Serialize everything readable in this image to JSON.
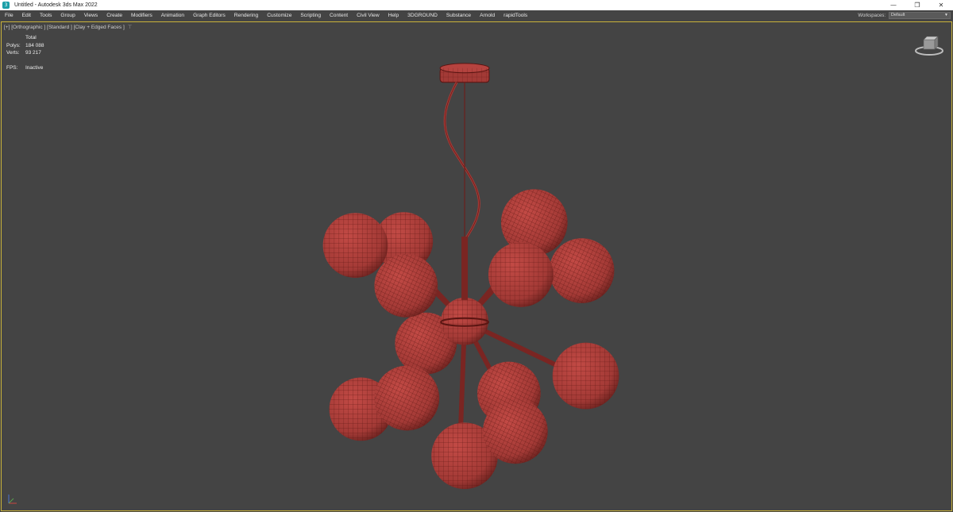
{
  "window": {
    "title": "Untitled - Autodesk 3ds Max 2022",
    "controls": {
      "minimize": "—",
      "restore": "❐",
      "close": "✕"
    }
  },
  "menubar": {
    "items": [
      {
        "label": "File"
      },
      {
        "label": "Edit"
      },
      {
        "label": "Tools"
      },
      {
        "label": "Group"
      },
      {
        "label": "Views"
      },
      {
        "label": "Create"
      },
      {
        "label": "Modifiers"
      },
      {
        "label": "Animation"
      },
      {
        "label": "Graph Editors"
      },
      {
        "label": "Rendering"
      },
      {
        "label": "Customize"
      },
      {
        "label": "Scripting"
      },
      {
        "label": "Content"
      },
      {
        "label": "Civil View"
      },
      {
        "label": "Help"
      },
      {
        "label": "3DGROUND"
      },
      {
        "label": "Substance"
      },
      {
        "label": "Arnold"
      },
      {
        "label": "rapidTools"
      }
    ],
    "workspace_label": "Workspaces:",
    "workspace_value": "Default"
  },
  "viewport": {
    "label": "[+] [Orthographic ] [Standard ] [Clay + Edged Faces ]",
    "filter_icon": "⊤",
    "stats": {
      "header": "Total",
      "polys_label": "Polys:",
      "polys_value": "184 088",
      "verts_label": "Verts:",
      "verts_value": "93 217",
      "fps_label": "FPS:",
      "fps_value": "Inactive"
    },
    "colors": {
      "background": "#444444",
      "clay": "#a33a36",
      "wire": "#5a1512",
      "active_border": "#c9b23a"
    }
  }
}
